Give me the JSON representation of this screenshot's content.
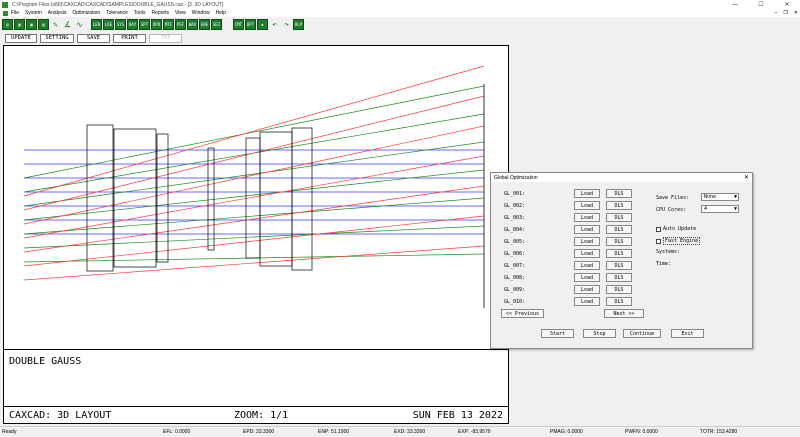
{
  "window": {
    "title": "C:\\Program Files (x86)\\CAXCAD\\CAXCAD\\SAMPLES\\DOUBLE_GAUSS.cax - [3. 3D LAYOUT]",
    "min": "—",
    "max": "☐",
    "close": "✕"
  },
  "menu": {
    "items": [
      "File",
      "System",
      "Analysis",
      "Optimization",
      "Tolerance",
      "Tools",
      "Reports",
      "View",
      "Window",
      "Help"
    ],
    "mdi_min": "–",
    "mdi_max": "❐",
    "mdi_close": "✕"
  },
  "toolbar": {
    "icons": [
      {
        "name": "new-file-icon",
        "glyph": "▤"
      },
      {
        "name": "open-folder-icon",
        "glyph": "▣"
      },
      {
        "name": "save-disk-icon",
        "glyph": "▦"
      },
      {
        "name": "print-icon",
        "glyph": "▥"
      },
      {
        "name": "edit-pencil-icon",
        "glyph": "✎"
      },
      {
        "name": "draw-icon",
        "glyph": "∡"
      },
      {
        "name": "wave-icon",
        "glyph": "∿"
      }
    ],
    "text_icons_1": [
      "LEN",
      "LDE",
      "SYS",
      "RAY",
      "SPT",
      "OPD",
      "MTF",
      "PSF",
      "WAV",
      "ENE",
      "SEI"
    ],
    "text_icons_2": [
      "CMT",
      "OPT"
    ],
    "tail_icons": [
      {
        "name": "gear-icon",
        "glyph": "✺"
      },
      {
        "name": "undo-icon",
        "glyph": "↶"
      },
      {
        "name": "redo-icon",
        "glyph": "↷"
      },
      {
        "name": "help-icon",
        "glyph": "HLP"
      }
    ]
  },
  "commands": {
    "update": "UPDATE",
    "setting": "SETTING",
    "save": "SAVE",
    "print": "PRINT",
    "text": "TXT"
  },
  "layout": {
    "lens_name": "DOUBLE GAUSS",
    "label": "CAXCAD: 3D LAYOUT",
    "zoom": "ZOOM: 1/1",
    "date": "SUN FEB 13 2022"
  },
  "dialog": {
    "title": "Global Optimization",
    "close": "✕",
    "slots": [
      {
        "label": "GL_001:",
        "load": "Load",
        "dls": "DLS"
      },
      {
        "label": "GL_002:",
        "load": "Load",
        "dls": "DLS"
      },
      {
        "label": "GL_003:",
        "load": "Load",
        "dls": "DLS"
      },
      {
        "label": "GL_004:",
        "load": "Load",
        "dls": "DLS"
      },
      {
        "label": "GL_005:",
        "load": "Load",
        "dls": "DLS"
      },
      {
        "label": "GL_006:",
        "load": "Load",
        "dls": "DLS"
      },
      {
        "label": "GL_007:",
        "load": "Load",
        "dls": "DLS"
      },
      {
        "label": "GL_008:",
        "load": "Load",
        "dls": "DLS"
      },
      {
        "label": "GL_009:",
        "load": "Load",
        "dls": "DLS"
      },
      {
        "label": "GL_010:",
        "load": "Load",
        "dls": "DLS"
      }
    ],
    "save_files_label": "Save Files:",
    "save_files_value": "None",
    "cpu_cores_label": "CPU Cores:",
    "cpu_cores_value": "4",
    "auto_update": "Auto Update",
    "fast_engine": "Fast Engine",
    "systems_label": "Systems:",
    "time_label": "Time:",
    "previous": "<< Previous",
    "next": "Next >>",
    "start": "Start",
    "stop": "Stop",
    "continue": "Continue",
    "exit": "Exit"
  },
  "statusbar": {
    "ready": "Ready",
    "efl": "EFL: 0.0000",
    "epd": "EPD: 33.3300",
    "enp": "ENP: 51.1900",
    "exd": "EXD: 33.3300",
    "exp": "EXP: -83.9570",
    "pmag": "PMAG: 0.0000",
    "pwfn": "PWFN: 0.0000",
    "totr": "TOTR: 153.4280"
  },
  "colors": {
    "ray_blue": "#3a3aff",
    "ray_green": "#1a8a1a",
    "ray_red": "#ff3a3a",
    "toolbar_green": "#1e7d2a"
  }
}
